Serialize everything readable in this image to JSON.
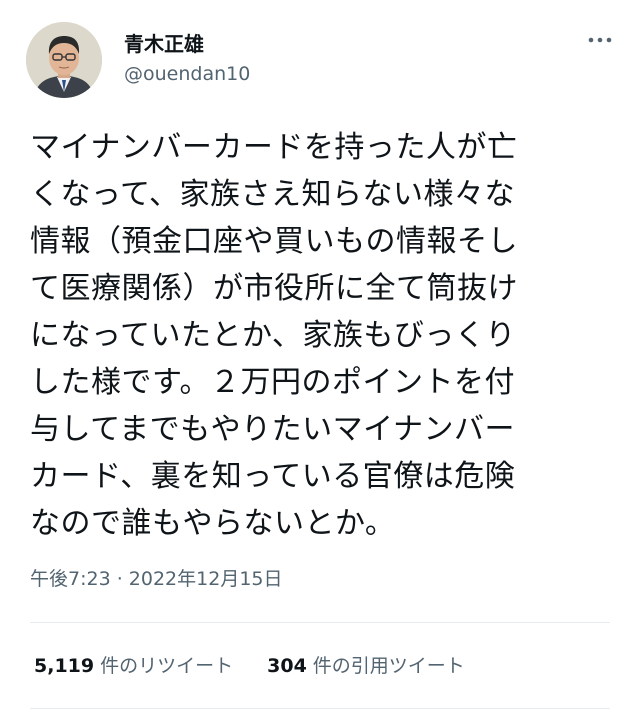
{
  "user": {
    "display_name": "青木正雄",
    "handle": "@ouendan10",
    "avatar_icon": "avatar"
  },
  "header": {
    "more_icon": "more-horizontal-icon"
  },
  "tweet": {
    "text_lines": [
      "マイナンバーカードを持った人が亡",
      "くなって、家族さえ知らない様々な",
      "情報（預金口座や買いもの情報そし",
      "て医療関係）が市役所に全て筒抜け",
      "になっていたとか、家族もびっくり",
      "した様です。２万円のポイントを付",
      "与してまでもやりたいマイナンバー",
      "カード、裏を知っている官僚は危険",
      "なので誰もやらないとか。"
    ],
    "timestamp": "午後7:23 · 2022年12月15日"
  },
  "stats": {
    "retweets_count": "5,119",
    "retweets_label": "件のリツイート",
    "quotes_count": "304",
    "quotes_label": "件の引用ツイート"
  },
  "colors": {
    "text": "#0f1419",
    "secondary": "#536471",
    "divider": "#e6ecf0"
  }
}
